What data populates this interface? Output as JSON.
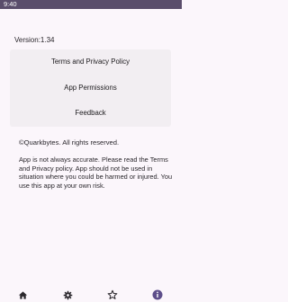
{
  "status_bar": {
    "time": "9:40"
  },
  "version_label": "Version:1.34",
  "menu": {
    "items": [
      {
        "label": "Terms and Privacy Policy"
      },
      {
        "label": "App Permissions"
      },
      {
        "label": "Feedback"
      }
    ]
  },
  "copyright": "©Quarkbytes. All rights reserved.",
  "disclaimer": "App is not always accurate. Please read the Terms and Privacy policy. App should not be used in situation where you could be harmed or injured. You use this app at your own risk.",
  "bottom_nav": {
    "items": [
      {
        "icon": "home-icon"
      },
      {
        "icon": "settings-icon"
      },
      {
        "icon": "star-icon"
      },
      {
        "icon": "info-icon",
        "selected": true
      }
    ]
  },
  "colors": {
    "status_bar": "#5a4d6b",
    "background": "#fbf6fb",
    "card": "#f2eef2",
    "selected_nav": "#5d4e8a"
  }
}
